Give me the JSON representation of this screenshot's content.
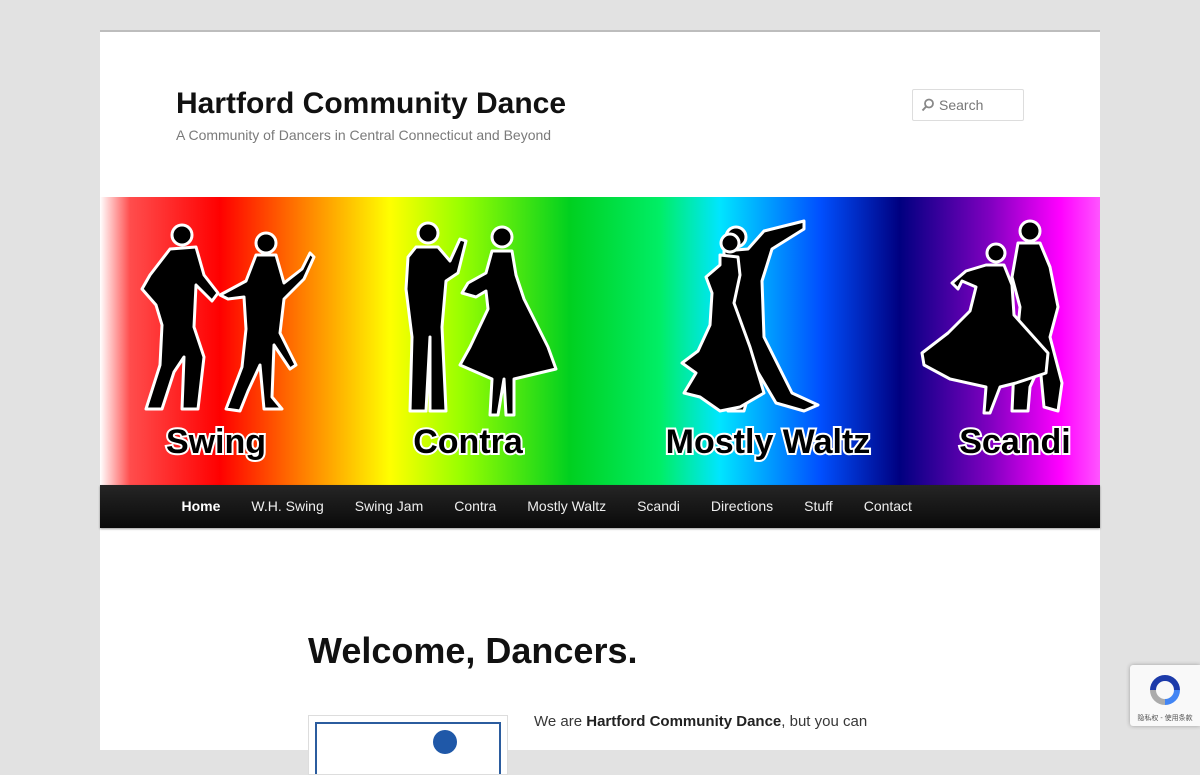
{
  "site": {
    "title": "Hartford Community Dance",
    "description": "A Community of Dancers in Central Connecticut and Beyond"
  },
  "search": {
    "placeholder": "Search"
  },
  "banner": {
    "labels": [
      "Swing",
      "Contra",
      "Mostly Waltz",
      "Scandi"
    ]
  },
  "nav": {
    "items": [
      "Home",
      "W.H. Swing",
      "Swing Jam",
      "Contra",
      "Mostly Waltz",
      "Scandi",
      "Directions",
      "Stuff",
      "Contact"
    ],
    "current": "Home"
  },
  "content": {
    "title": "Welcome, Dancers.",
    "intro_prefix": "We are ",
    "intro_bold": "Hartford Community Dance",
    "intro_suffix": ", but you can"
  },
  "recaptcha": {
    "links": "隐私权 - 使用条款"
  },
  "colors": {
    "nav_bg": "#1a1a1a",
    "accent_blue": "#1f58a8"
  }
}
